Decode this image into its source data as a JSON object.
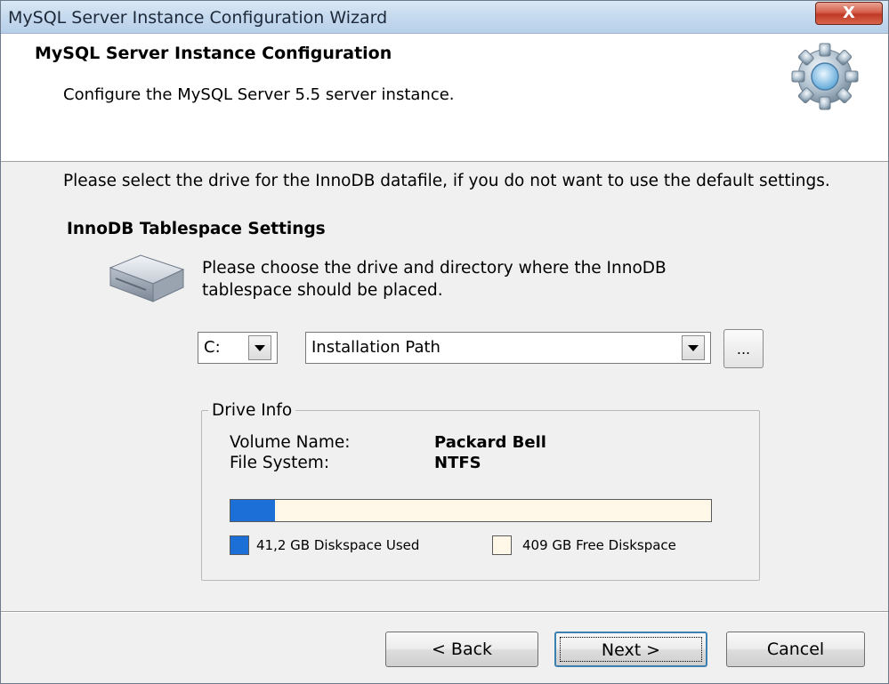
{
  "window": {
    "title": "MySQL Server Instance Configuration Wizard",
    "close_label": "X"
  },
  "header": {
    "title": "MySQL Server Instance Configuration",
    "subtitle": "Configure the MySQL Server 5.5 server instance."
  },
  "content": {
    "instruction": "Please select the drive for the InnoDB datafile, if you do not want to use the default settings.",
    "section_title": "InnoDB Tablespace Settings",
    "choose_text": "Please choose the drive and directory where the InnoDB tablespace should be placed.",
    "drive_select": {
      "value": "C:"
    },
    "path_select": {
      "value": "Installation Path"
    },
    "browse_label": "...",
    "drive_info": {
      "legend": "Drive Info",
      "volume_name_label": "Volume Name:",
      "volume_name_value": "Packard Bell",
      "file_system_label": "File System:",
      "file_system_value": "NTFS",
      "used_fraction": 0.092,
      "used_label": "41,2 GB Diskspace Used",
      "free_label": "409 GB Free Diskspace",
      "used_color": "#1c6fd6",
      "free_color": "#fff8e8"
    }
  },
  "buttons": {
    "back": "< Back",
    "next": "Next >",
    "cancel": "Cancel"
  },
  "icons": {
    "header": "gear-icon",
    "drive": "hard-drive-icon",
    "dropdown": "chevron-down-icon"
  }
}
